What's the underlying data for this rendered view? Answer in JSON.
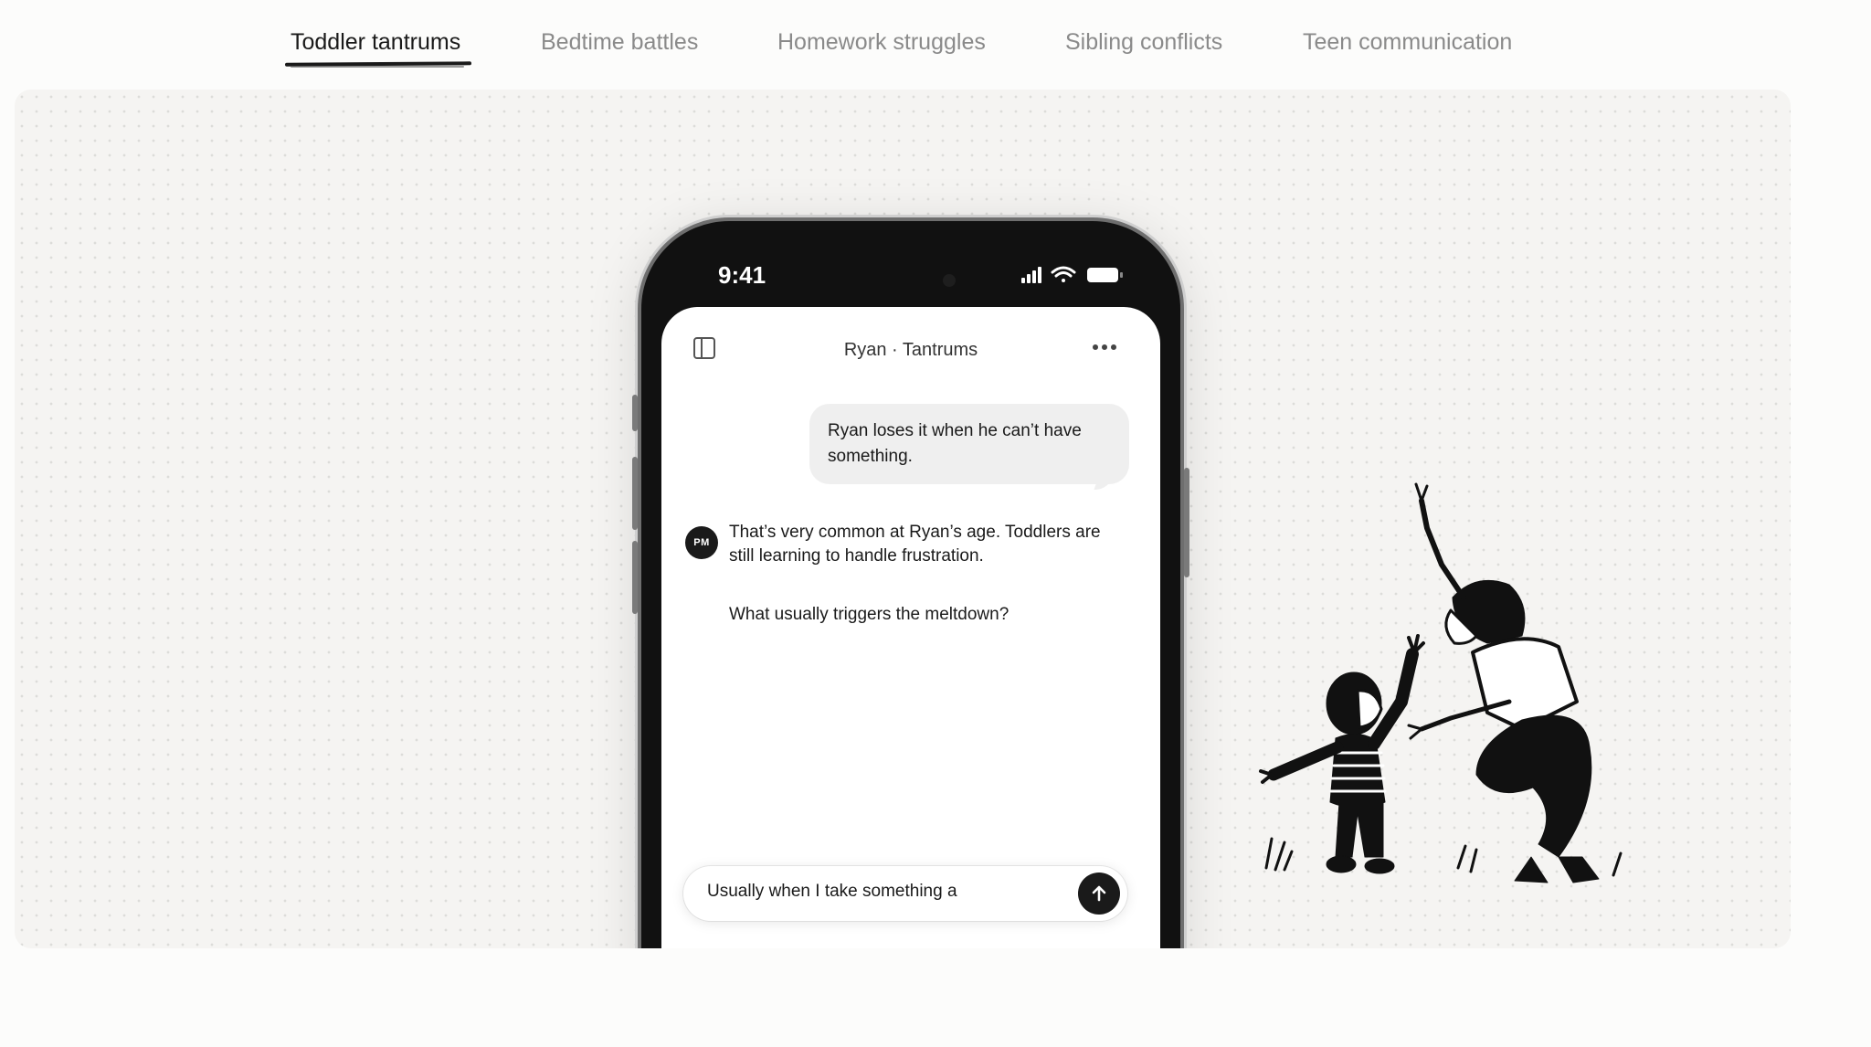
{
  "tabs": [
    {
      "label": "Toddler tantrums",
      "active": true
    },
    {
      "label": "Bedtime battles",
      "active": false
    },
    {
      "label": "Homework struggles",
      "active": false
    },
    {
      "label": "Sibling conflicts",
      "active": false
    },
    {
      "label": "Teen communication",
      "active": false
    }
  ],
  "phone": {
    "status_time": "9:41",
    "chat_title": "Ryan · Tantrums",
    "messages": {
      "user": "Ryan loses it when he can’t have something.",
      "assistant_avatar": "PM",
      "assistant_p1": "That’s very common at Ryan’s age. Toddlers are still learning to handle frustration.",
      "assistant_p2": "What usually triggers the meltdown?"
    },
    "input_value": "Usually when I take something a"
  },
  "icons": {
    "sidebar": "sidebar-toggle-icon",
    "more": "more-horizontal-icon",
    "send": "arrow-up-icon",
    "signal": "signal-icon",
    "wifi": "wifi-icon",
    "battery": "battery-icon"
  },
  "colors": {
    "accent": "#1a1a1a",
    "inactive_tab": "#8a8a8a",
    "stage_bg": "#f5f4f2",
    "bubble_bg": "#efefef"
  }
}
